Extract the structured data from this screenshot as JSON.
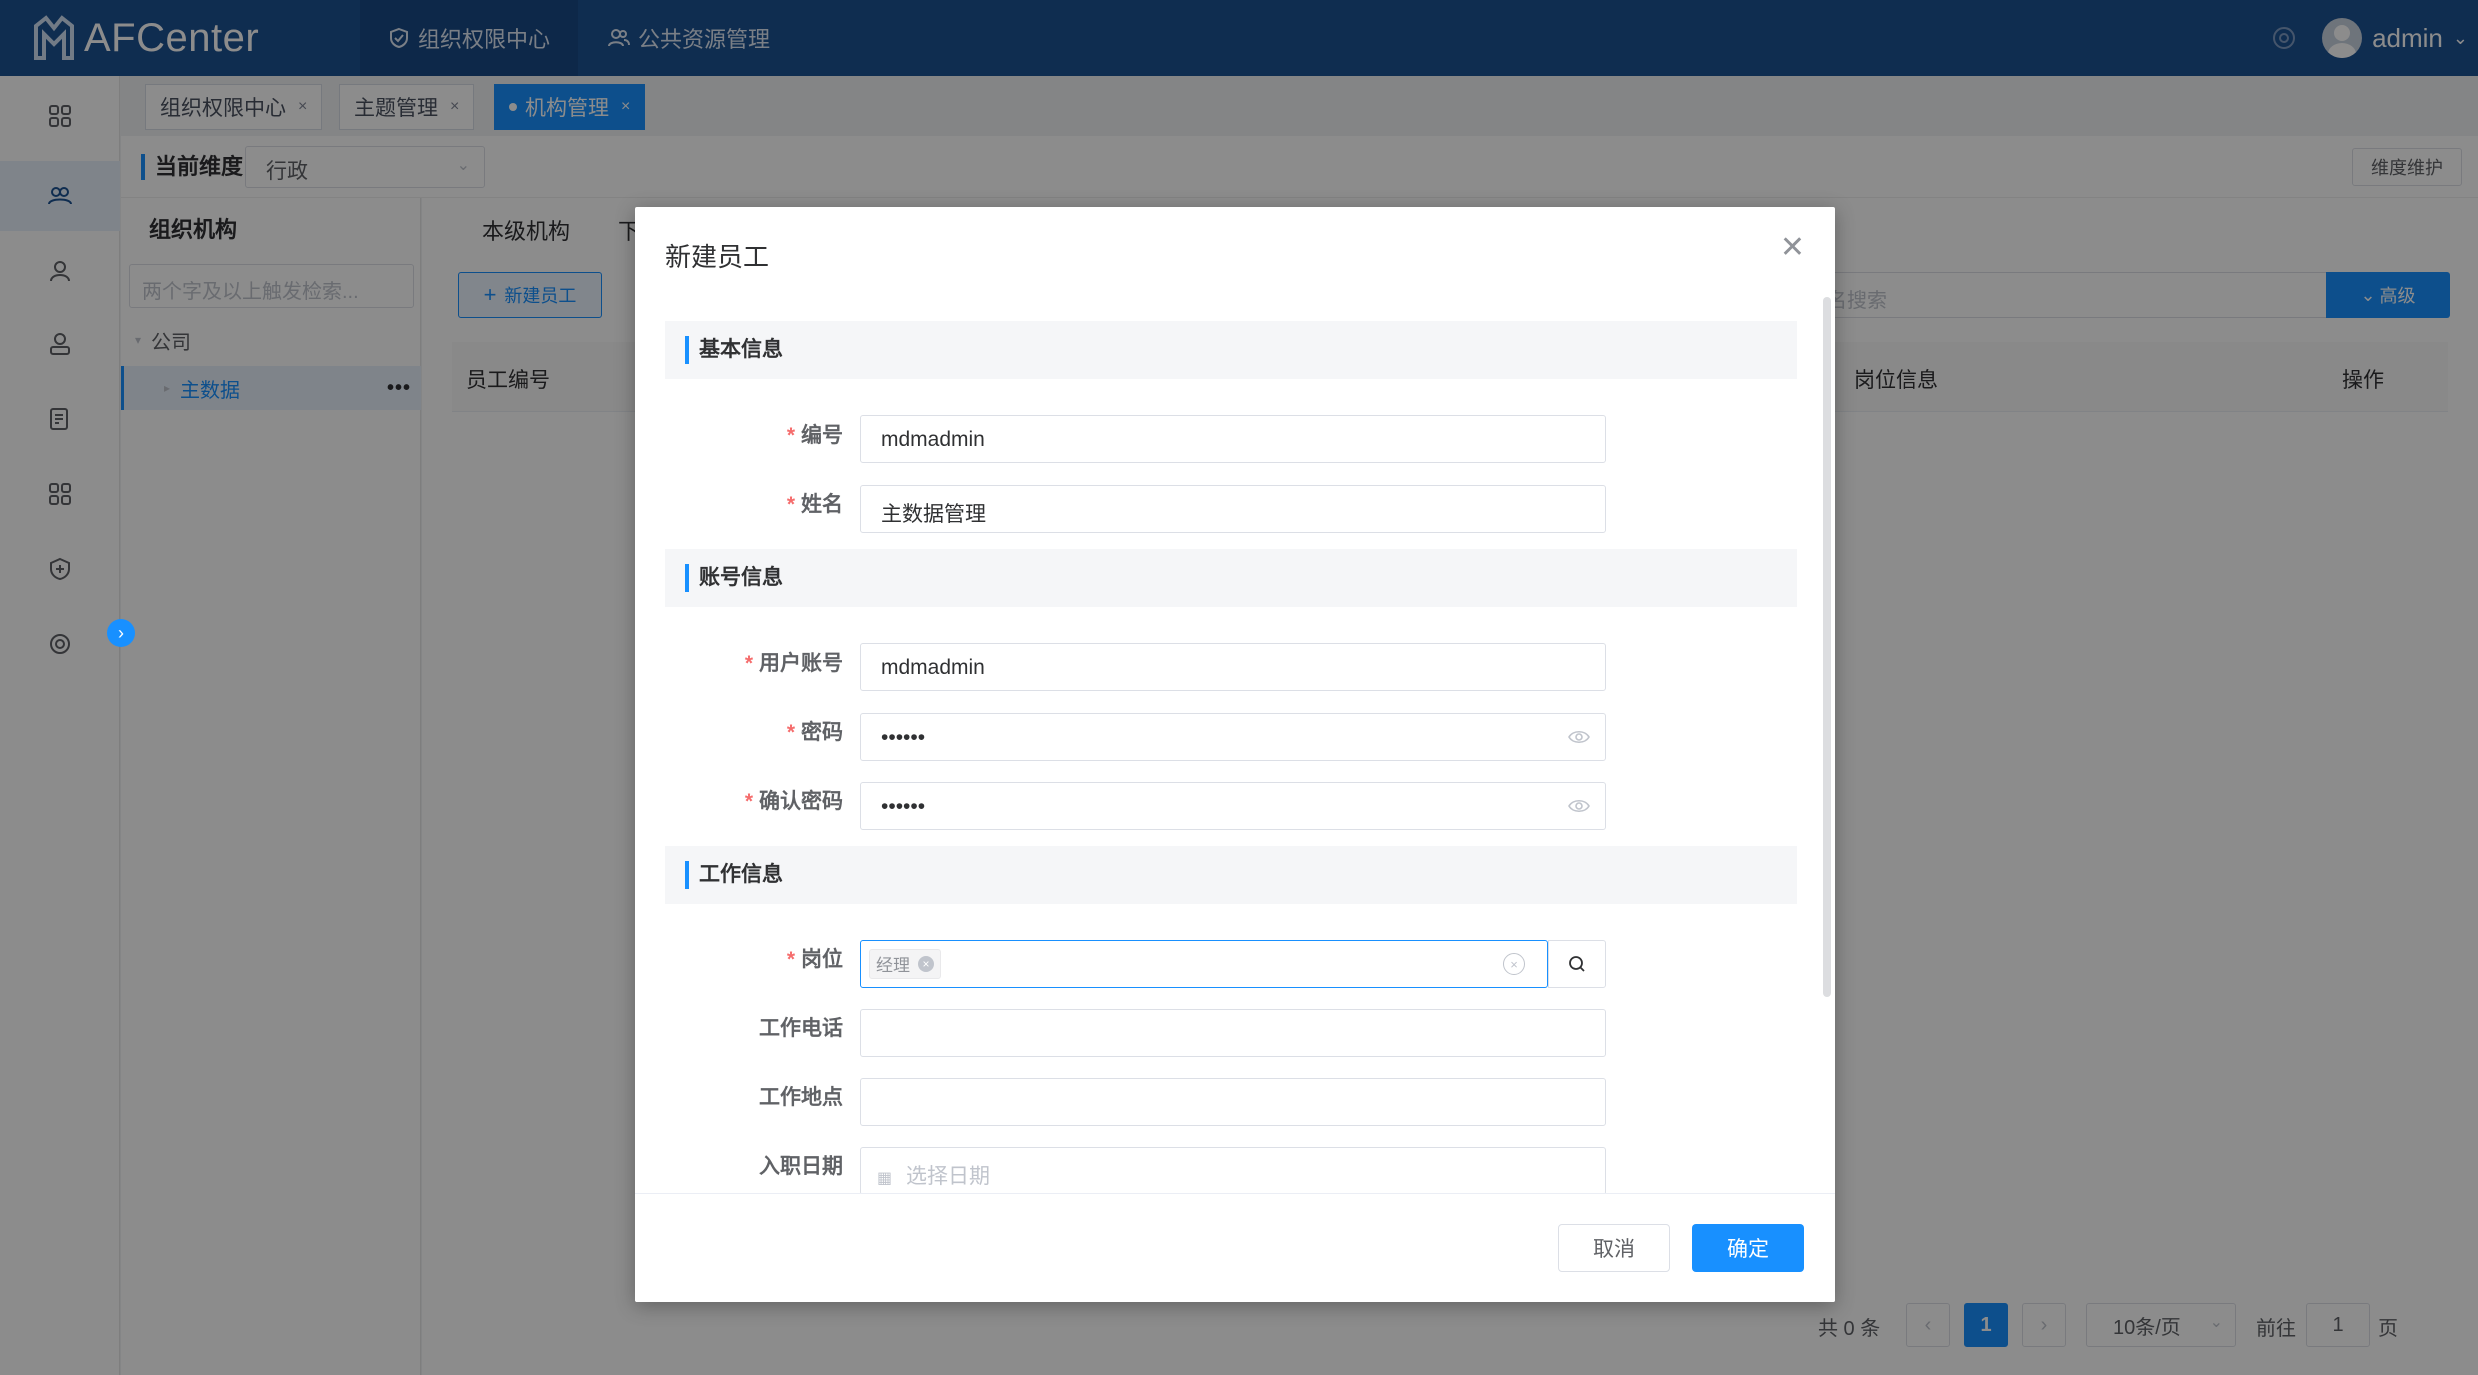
{
  "app": {
    "name": "AFCenter"
  },
  "topnav": [
    {
      "label": "组织权限中心",
      "icon": "shield-icon",
      "active": true
    },
    {
      "label": "公共资源管理",
      "icon": "users-icon",
      "active": false
    }
  ],
  "user": {
    "name": "admin"
  },
  "tabs": [
    {
      "label": "组织权限中心",
      "active": false
    },
    {
      "label": "主题管理",
      "active": false
    },
    {
      "label": "机构管理",
      "active": true
    }
  ],
  "dimension": {
    "label": "当前维度",
    "value": "行政",
    "maintain_button": "维度维护"
  },
  "org_panel": {
    "title": "组织机构",
    "search_placeholder": "两个字及以上触发检索...",
    "tree": [
      {
        "label": "公司",
        "level": 0,
        "selected": false
      },
      {
        "label": "主数据",
        "level": 1,
        "selected": true
      }
    ]
  },
  "main": {
    "subtabs": [
      "本级机构",
      "下"
    ],
    "new_employee_button": "新建员工",
    "search_placeholder": "名搜索",
    "advanced_button": "高级",
    "columns": [
      "员工编号",
      "岗位信息",
      "操作"
    ],
    "pagination": {
      "total": "共 0 条",
      "current_page": "1",
      "page_size": "10条/页",
      "goto_label": "前往",
      "goto_value": "1",
      "page_suffix": "页"
    }
  },
  "dialog": {
    "title": "新建员工",
    "sections": {
      "basic": "基本信息",
      "account": "账号信息",
      "work": "工作信息"
    },
    "fields": {
      "code": {
        "label": "编号",
        "value": "mdmadmin",
        "required": true
      },
      "name": {
        "label": "姓名",
        "value": "主数据管理",
        "required": true
      },
      "account": {
        "label": "用户账号",
        "value": "mdmadmin",
        "required": true
      },
      "password": {
        "label": "密码",
        "value": "••••••",
        "required": true
      },
      "confirm_password": {
        "label": "确认密码",
        "value": "••••••",
        "required": true
      },
      "position": {
        "label": "岗位",
        "tag": "经理",
        "required": true
      },
      "work_phone": {
        "label": "工作电话",
        "value": ""
      },
      "work_location": {
        "label": "工作地点",
        "value": ""
      },
      "hire_date": {
        "label": "入职日期",
        "placeholder": "选择日期"
      }
    },
    "cancel_button": "取消",
    "confirm_button": "确定"
  },
  "colors": {
    "brand": "#1d5293",
    "primary": "#1890ff",
    "required": "#f56c6c"
  }
}
